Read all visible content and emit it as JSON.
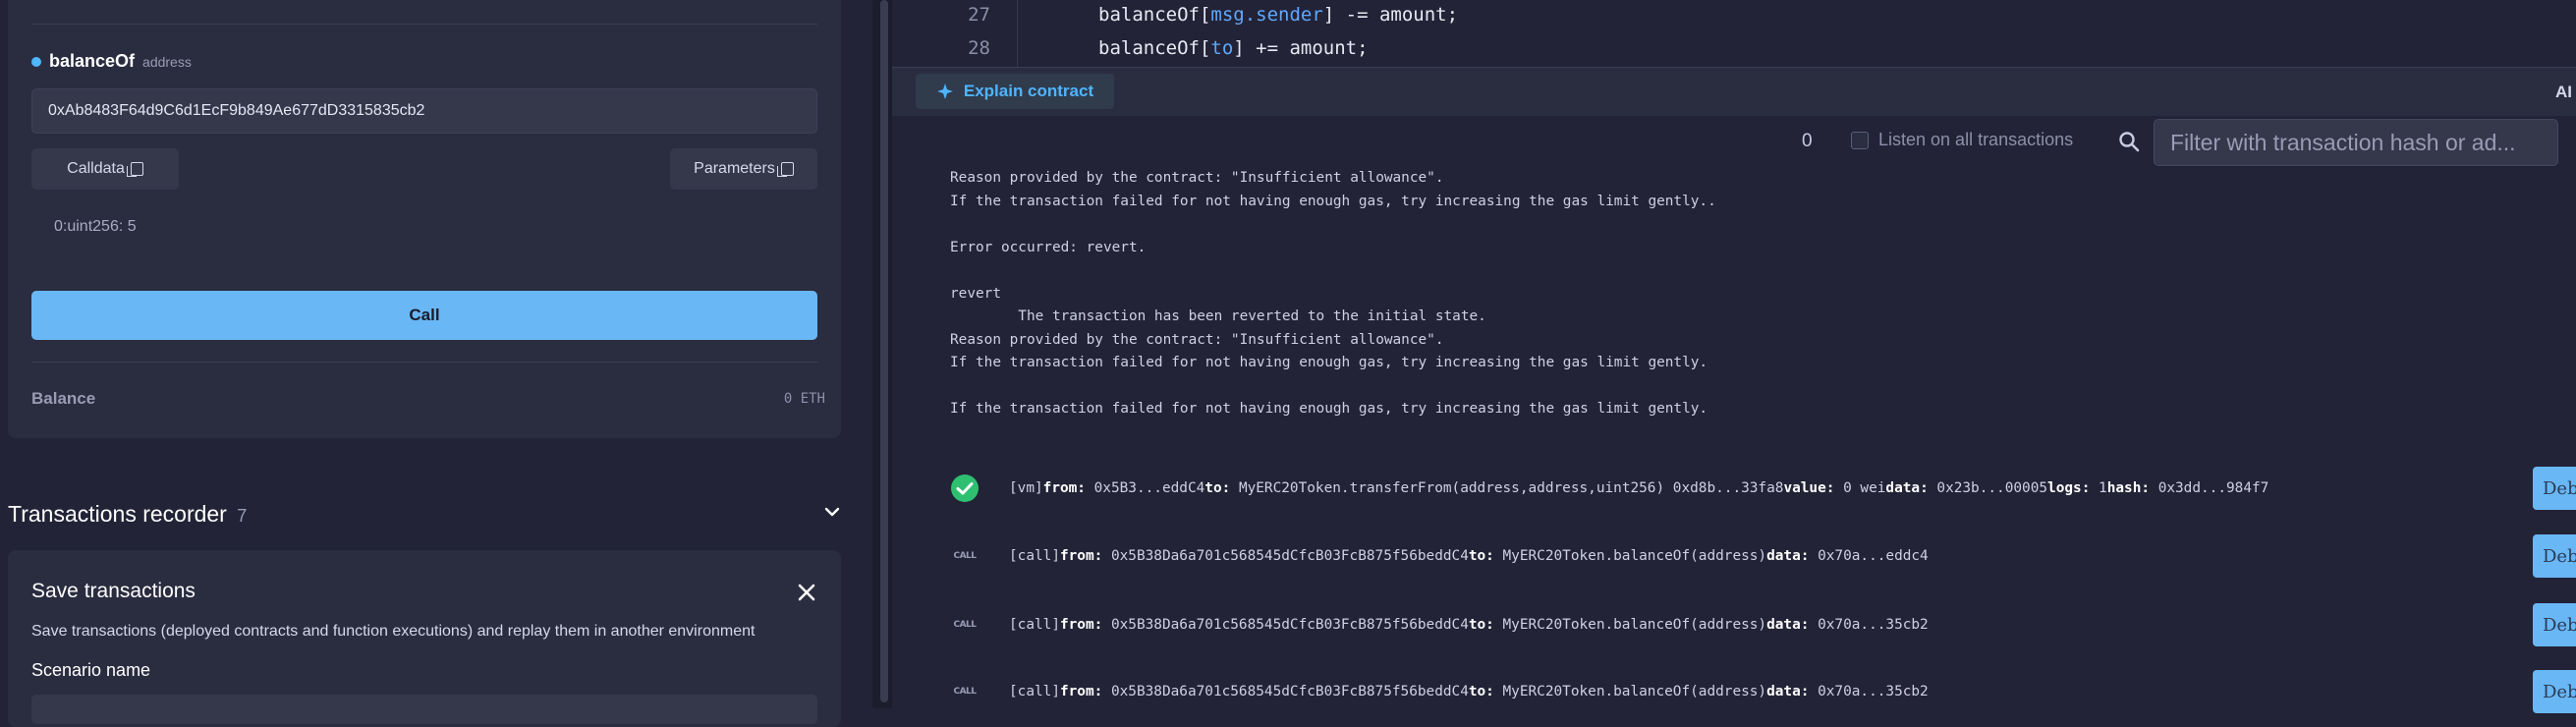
{
  "function_panel": {
    "name": "balanceOf",
    "param_type": "address",
    "address_value": "0xAb8483F64d9C6d1EcF9b849Ae677dD3315835cb2",
    "calldata_label": "Calldata",
    "parameters_label": "Parameters",
    "result": "0:uint256: 5",
    "call_label": "Call",
    "balance_label": "Balance",
    "balance_value": "0 ETH"
  },
  "recorder": {
    "title": "Transactions recorder",
    "count": "7",
    "save_title": "Save transactions",
    "save_description": "Save transactions (deployed contracts and function executions) and replay them in another environment",
    "scenario_label": "Scenario name"
  },
  "editor": {
    "lines": [
      {
        "num": "27",
        "pre": "balanceOf[",
        "kw": "msg.sender",
        "post": "] -= amount;"
      },
      {
        "num": "28",
        "pre": "balanceOf[",
        "kw": "to",
        "post": "] += amount;"
      }
    ]
  },
  "terminal": {
    "explain_label": "Explain contract",
    "ai_label": "AI",
    "pending_count": "0",
    "listen_label": "Listen on all transactions",
    "filter_placeholder": "Filter with transaction hash or ad...",
    "log_lines": [
      "Reason provided by the contract: \"Insufficient allowance\".",
      "If the transaction failed for not having enough gas, try increasing the gas limit gently..",
      "",
      "Error occurred: revert.",
      "",
      "revert",
      "        The transaction has been reverted to the initial state.",
      "Reason provided by the contract: \"Insufficient allowance\".",
      "If the transaction failed for not having enough gas, try increasing the gas limit gently.",
      "",
      "If the transaction failed for not having enough gas, try increasing the gas limit gently."
    ],
    "transactions": [
      {
        "kind": "vm",
        "icon": "check",
        "tag": "[vm]",
        "from": "0x5B3...eddC4",
        "to": "MyERC20Token.transferFrom(address,address,uint256) 0xd8b...33fa8",
        "value": "0 wei",
        "data": "0x23b...00005",
        "logs": "1",
        "hash": "0x3dd...984f7",
        "debug": "Debug"
      },
      {
        "kind": "call",
        "icon": "CALL",
        "tag": "[call]",
        "from": "0x5B38Da6a701c568545dCfcB03FcB875f56beddC4",
        "to": "MyERC20Token.balanceOf(address)",
        "data": "0x70a...eddc4",
        "debug": "Debug"
      },
      {
        "kind": "call",
        "icon": "CALL",
        "tag": "[call]",
        "from": "0x5B38Da6a701c568545dCfcB03FcB875f56beddC4",
        "to": "MyERC20Token.balanceOf(address)",
        "data": "0x70a...35cb2",
        "debug": "Debug"
      },
      {
        "kind": "call",
        "icon": "CALL",
        "tag": "[call]",
        "from": "0x5B38Da6a701c568545dCfcB03FcB875f56beddC4",
        "to": "MyERC20Token.balanceOf(address)",
        "data": "0x70a...35cb2",
        "debug": "Debug"
      }
    ]
  },
  "colors": {
    "accent": "#4fb5ff",
    "button_blue": "#6ab7f5",
    "success_green": "#2fbf71",
    "background": "#222336"
  }
}
